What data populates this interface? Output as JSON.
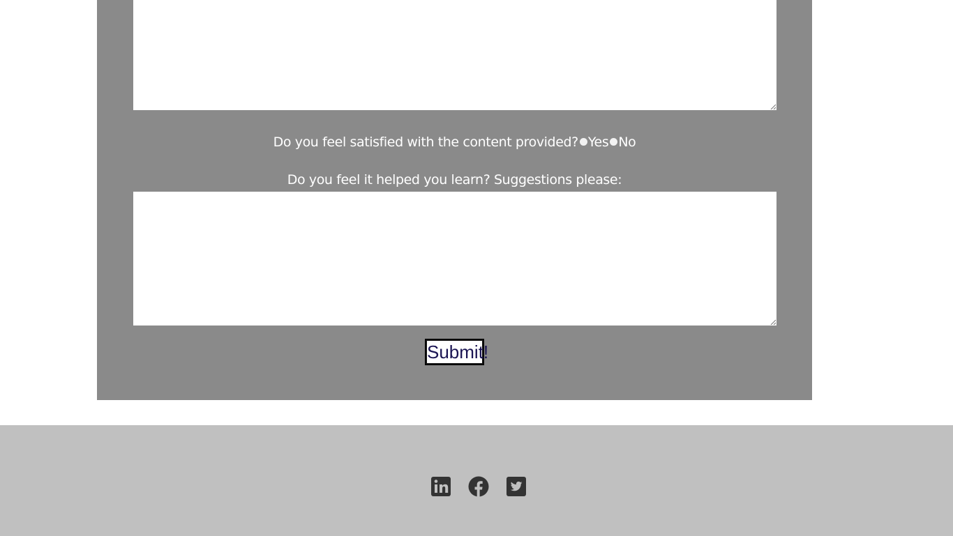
{
  "form": {
    "question_satisfied": "Do you feel satisfied with the content provided?",
    "option_yes": "Yes",
    "option_no": "No",
    "question_learn": "Do you feel it helped you learn? Suggestions please:",
    "submit_label": "Submit!"
  },
  "footer": {
    "social_links": [
      "linkedin-icon",
      "facebook-icon",
      "twitter-icon"
    ]
  },
  "colors": {
    "panel": "#8a8a8a",
    "footer": "#c0c0c0",
    "icon": "#333333",
    "submit_text": "#1b1553"
  }
}
